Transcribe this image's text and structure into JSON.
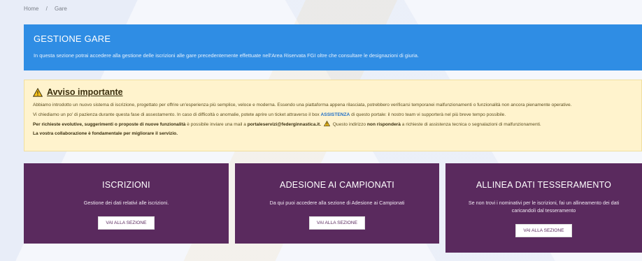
{
  "breadcrumb": {
    "home": "Home",
    "separator": "/",
    "current": "Gare"
  },
  "header": {
    "title": "GESTIONE GARE",
    "description": "In questa sezione potrai accedere alla gestione delle iscrizioni alle gare precedentemente effettuate nell'Area Riservata FGI oltre che consultare le designazioni di giuria."
  },
  "alert": {
    "icon": "warning-icon",
    "title": "Avviso importante",
    "p1": "Abbiamo introdotto un nuovo sistema di iscrizione, progettato per offrire un'esperienza più semplice, veloce e moderna. Essendo una piattaforma appena rilasciata, potrebbero verificarsi temporanei malfunzionamenti o funzionalità non ancora pienamente operative.",
    "p2_before": "Vi chiediamo un po' di pazienza durante questa fase di assestamento. In caso di difficoltà o anomalie, potete aprire un ticket attraverso il box ",
    "p2_link": "ASSISTENZA",
    "p2_after": " di questo portale: il nostro team vi supporterà nel più breve tempo possibile.",
    "p3_bold": "Per richieste evolutive, suggerimenti o proposte di nuove funzionalità",
    "p3_mid": " è possibile inviare una mail a ",
    "p3_email": "portaleservizi@federginnastica.it.",
    "p3_after1": " Questo indirizzo ",
    "p3_bold2": "non risponderà",
    "p3_after2": " a richieste di assistenza tecnica o segnalazioni di malfunzionamenti.",
    "p4": "La vostra collaborazione è fondamentale per migliorare il servizio."
  },
  "cards": [
    {
      "title": "ISCRIZIONI",
      "description": "Gestione dei dati relativi alle iscrizioni.",
      "button": "VAI ALLA SEZIONE"
    },
    {
      "title": "ADESIONE AI CAMPIONATI",
      "description": "Da qui puoi accedere alla sezione di Adesione ai Campionati",
      "button": "VAI ALLA SEZIONE"
    },
    {
      "title": "ALLINEA DATI TESSERAMENTO",
      "description": "Se non trovi i nominativi per le iscrizioni, fai un allineamento dei dati caricandoli dal tesseramento",
      "button": "VAI ALLA SEZIONE"
    }
  ],
  "colors": {
    "header_bg": "#2f8de4",
    "card_bg": "#5a2a5e",
    "alert_bg": "#fff3cd",
    "link": "#1f6fc7"
  }
}
